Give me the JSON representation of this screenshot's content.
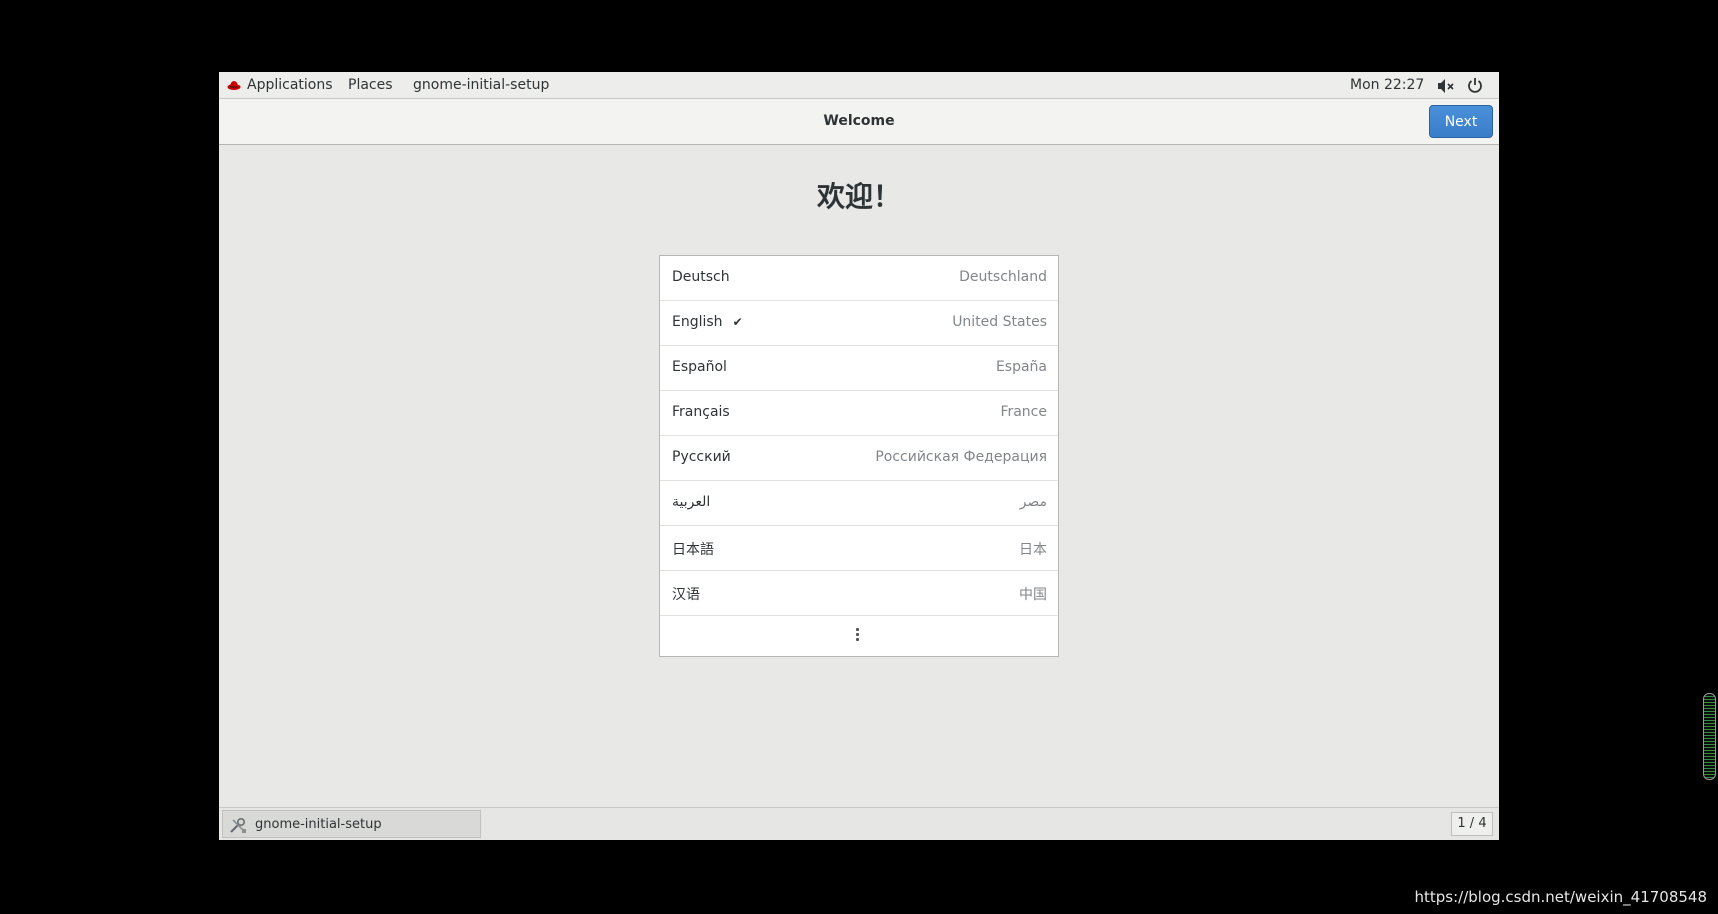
{
  "top_panel": {
    "applications_label": "Applications",
    "places_label": "Places",
    "app_name": "gnome-initial-setup",
    "clock": "Mon 22:27"
  },
  "header": {
    "title": "Welcome",
    "next_label": "Next"
  },
  "main": {
    "welcome_text": "欢迎！",
    "languages": [
      {
        "name": "Deutsch",
        "region": "Deutschland",
        "selected": false
      },
      {
        "name": "English",
        "region": "United States",
        "selected": true,
        "check": "✔"
      },
      {
        "name": "Español",
        "region": "España",
        "selected": false
      },
      {
        "name": "Français",
        "region": "France",
        "selected": false
      },
      {
        "name": "Русский",
        "region": "Российская Федерация",
        "selected": false
      },
      {
        "name": "العربية",
        "region": "مصر",
        "selected": false
      },
      {
        "name": "日本語",
        "region": "日本",
        "selected": false
      },
      {
        "name": "汉语",
        "region": "中国",
        "selected": false
      }
    ]
  },
  "taskbar": {
    "task_label": "gnome-initial-setup",
    "workspace": "1 / 4"
  },
  "watermark": "https://blog.csdn.net/weixin_41708548",
  "colors": {
    "accent": "#3a7dc9",
    "logo": "#cc0000"
  }
}
